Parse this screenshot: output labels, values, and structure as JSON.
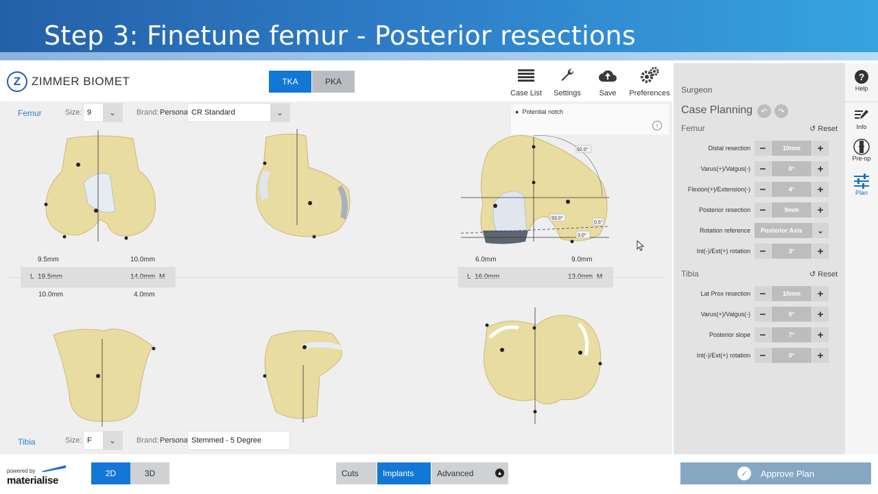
{
  "banner": {
    "title": "Step 3: Finetune femur - Posterior resections"
  },
  "header": {
    "logo_text": "ZIMMER BIOMET",
    "logo_mark": "Z",
    "type_toggle": {
      "tka": "TKA",
      "pka": "PKA",
      "selected": "TKA"
    },
    "tools": [
      {
        "label": "Case List",
        "icon": "list-icon"
      },
      {
        "label": "Settings",
        "icon": "wrench-icon"
      },
      {
        "label": "Save",
        "icon": "cloud-upload-icon"
      },
      {
        "label": "Preferences",
        "icon": "gears-icon"
      }
    ]
  },
  "femur": {
    "label": "Femur",
    "size_label": "Size:",
    "size_value": "9",
    "brand_label": "Brand:",
    "brand_value": "Persona",
    "implant_value": "CR Standard"
  },
  "tibia": {
    "label": "Tibia",
    "size_label": "Size:",
    "size_value": "F",
    "brand_label": "Brand:",
    "brand_value": "Persona",
    "implant_value": "Stemmed - 5 Degree"
  },
  "notch": {
    "text": "Potential notch"
  },
  "measurements": {
    "front_top_left": "9.5mm",
    "front_top_right": "10.0mm",
    "front_bar_l": "L",
    "front_bar_left": "19.5mm",
    "front_bar_right": "14.0mm",
    "front_bar_m": "M",
    "front_bottom_left": "10.0mm",
    "front_bottom_right": "4.0mm",
    "axial_top_left": "6.0mm",
    "axial_top_right": "9.0mm",
    "axial_bar_l": "L",
    "axial_bar_left": "16.0mm",
    "axial_bar_right": "13.0mm",
    "axial_bar_m": "M",
    "angle_1": "92.0°",
    "angle_2": "93.0°",
    "angle_3": "0.5°",
    "angle_4": "3.0°"
  },
  "bottom": {
    "powered_by": "powered by",
    "materialise": "materialise",
    "mode_2d": "2D",
    "mode_3d": "3D",
    "tabs": [
      "Cuts",
      "Implants",
      "Advanced"
    ],
    "active_tab": "Implants"
  },
  "panel": {
    "surgeon": "Surgeon",
    "title": "Case Planning",
    "femur_title": "Femur",
    "reset": "Reset",
    "femur_rows": [
      {
        "label": "Distal resection",
        "value": "10mm"
      },
      {
        "label": "Varus(+)/Valgus(-)",
        "value": "0°"
      },
      {
        "label": "Flexion(+)/Extension(-)",
        "value": "4°"
      },
      {
        "label": "Posterior resection",
        "value": "9mm"
      },
      {
        "label": "Rotation reference",
        "value": "Posterior Axis"
      },
      {
        "label": "Int(-)/Ext(+) rotation",
        "value": "3°"
      }
    ],
    "tibia_title": "Tibia",
    "tibia_rows": [
      {
        "label": "Lat Prox resection",
        "value": "10mm"
      },
      {
        "label": "Varus(+)/Valgus(-)",
        "value": "0°"
      },
      {
        "label": "Posterior slope",
        "value": "7°"
      },
      {
        "label": "Int(-)/Ext(+) rotation",
        "value": "0°"
      }
    ],
    "approve": "Approve Plan"
  },
  "sidenav": [
    {
      "label": "Help",
      "icon": "help-icon"
    },
    {
      "label": "Info",
      "icon": "edit-icon"
    },
    {
      "label": "Pre-op",
      "icon": "knee-icon"
    },
    {
      "label": "Plan",
      "icon": "sliders-icon"
    }
  ],
  "colors": {
    "accent": "#1277d5",
    "bone": "#e8dca0",
    "banner": "#2e7cc6",
    "approve": "#85a7c3"
  }
}
